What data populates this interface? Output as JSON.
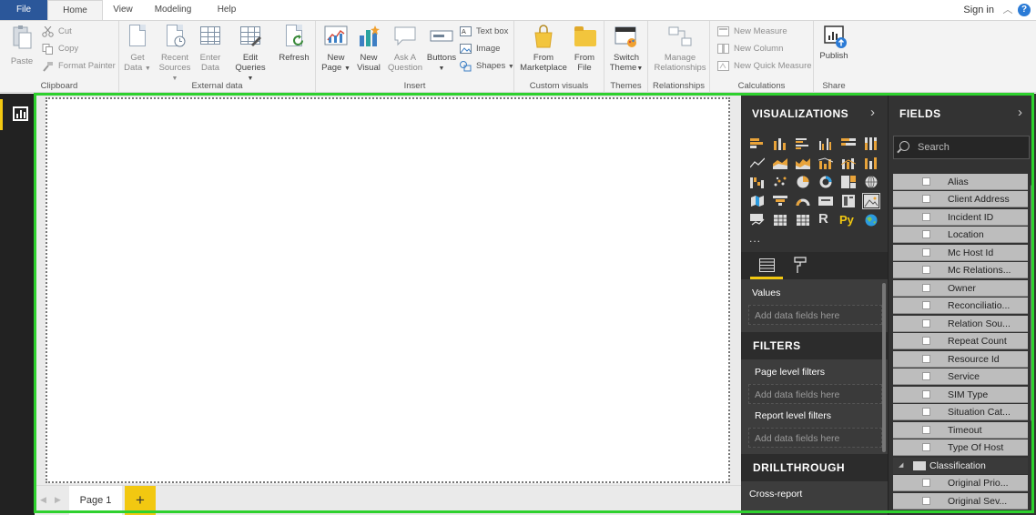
{
  "menu": {
    "tabs": [
      "File",
      "Home",
      "View",
      "Modeling",
      "Help"
    ],
    "signin": "Sign in",
    "help_glyph": "?"
  },
  "ribbon": {
    "clipboard": {
      "label": "Clipboard",
      "paste": "Paste",
      "cut": "Cut",
      "copy": "Copy",
      "format_painter": "Format Painter"
    },
    "external": {
      "label": "External data",
      "get_data": "Get Data",
      "recent_sources": "Recent Sources",
      "enter_data": "Enter Data",
      "edit_queries": "Edit Queries",
      "refresh": "Refresh"
    },
    "insert": {
      "label": "Insert",
      "new_page": "New Page",
      "new_visual": "New Visual",
      "ask_question": "Ask A Question",
      "buttons": "Buttons",
      "text_box": "Text box",
      "image": "Image",
      "shapes": "Shapes"
    },
    "custom_visuals": {
      "label": "Custom visuals",
      "from_marketplace": "From Marketplace",
      "from_file": "From File"
    },
    "themes": {
      "label": "Themes",
      "switch_theme": "Switch Theme"
    },
    "relationships": {
      "label": "Relationships",
      "manage": "Manage Relationships"
    },
    "calculations": {
      "label": "Calculations",
      "new_measure": "New Measure",
      "new_column": "New Column",
      "new_quick_measure": "New Quick Measure"
    },
    "share": {
      "label": "Share",
      "publish": "Publish"
    }
  },
  "canvas": {
    "page_tab": "Page 1",
    "add_page": "+"
  },
  "visualizations": {
    "title": "VISUALIZATIONS",
    "more": "...",
    "values_label": "Values",
    "values_placeholder": "Add data fields here",
    "filters_title": "FILTERS",
    "page_level_filters": "Page level filters",
    "page_level_placeholder": "Add data fields here",
    "report_level_filters": "Report level filters",
    "report_level_placeholder": "Add data fields here",
    "drillthrough_title": "DRILLTHROUGH",
    "cross_report": "Cross-report",
    "custom_r": "R",
    "custom_py": "Py"
  },
  "fields": {
    "title": "FIELDS",
    "search_placeholder": "Search",
    "items": [
      "Alias",
      "Client Address",
      "Incident ID",
      "Location",
      "Mc Host Id",
      "Mc Relations...",
      "Owner",
      "Reconciliatio...",
      "Relation Sou...",
      "Repeat Count",
      "Resource Id",
      "Service",
      "SIM Type",
      "Situation Cat...",
      "Timeout",
      "Type Of Host"
    ],
    "table": "Classification",
    "table_items": [
      "Original Prio...",
      "Original Sev..."
    ]
  }
}
